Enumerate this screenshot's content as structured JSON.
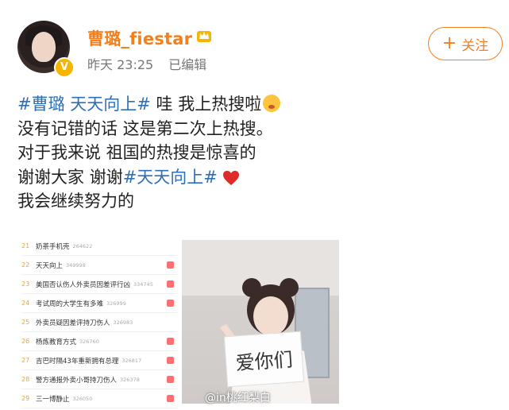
{
  "header": {
    "username": "曹璐_fiestar",
    "time_label": "昨天 23:25",
    "edited_label": "已编辑",
    "follow_label": "关注"
  },
  "post": {
    "line1_tag": "#曹璐 天天向上#",
    "line1_text": " 哇 我上热搜啦",
    "line2": "没有记错的话 这是第二次上热搜。",
    "line3": "对于我来说 祖国的热搜是惊喜的",
    "line4_text": "谢谢大家 谢谢",
    "line4_tag": "#天天向上#",
    "line5": "我会继续努力的"
  },
  "trend_list": [
    {
      "rank": "21",
      "title": "奶茶手机壳",
      "count": "264622",
      "hot": false
    },
    {
      "rank": "22",
      "title": "天天向上",
      "count": "349998",
      "hot": true
    },
    {
      "rank": "23",
      "title": "美国否认伤人外卖员因差评行凶",
      "count": "334745",
      "hot": true
    },
    {
      "rank": "24",
      "title": "考试周的大学生有多难",
      "count": "326999",
      "hot": true
    },
    {
      "rank": "25",
      "title": "外卖员疑因差评持刀伤人",
      "count": "326983",
      "hot": false
    },
    {
      "rank": "26",
      "title": "杨炼教育方式",
      "count": "326760",
      "hot": true
    },
    {
      "rank": "27",
      "title": "吉巴时隔43年重新拥有总理",
      "count": "326817",
      "hot": true
    },
    {
      "rank": "28",
      "title": "警方通报外卖小哥持刀伤人",
      "count": "326378",
      "hot": true
    },
    {
      "rank": "29",
      "title": "三一博静止",
      "count": "326050",
      "hot": true
    }
  ],
  "photo": {
    "sign_text": "爱你们",
    "watermark": "@in桃红梨白"
  },
  "colors": {
    "username": "#f3801d",
    "hashtag": "#2f6fb5",
    "follow": "#f3801d"
  }
}
